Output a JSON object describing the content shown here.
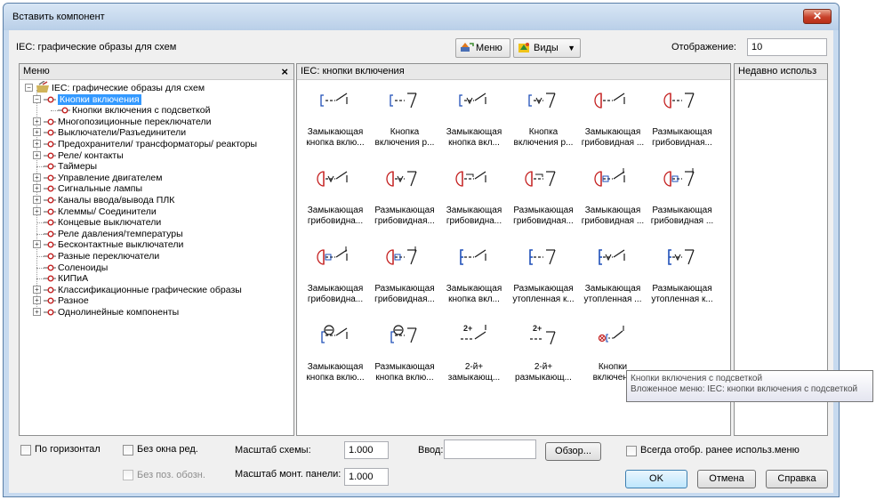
{
  "window": {
    "title": "Вставить компонент",
    "close_glyph": "✕"
  },
  "toolbar": {
    "path_label": "IEC: графические образы для схем",
    "menu_button": "Меню",
    "views_button": "Виды",
    "display_label": "Отображение:",
    "display_value": "10"
  },
  "menu_panel": {
    "header": "Меню",
    "close_glyph": "×",
    "tree": [
      {
        "label": "IEC: графические образы для схем",
        "level": 0,
        "expander": "−",
        "icon": "root"
      },
      {
        "label": "Кнопки включения",
        "level": 1,
        "expander": "−",
        "selected": true
      },
      {
        "label": "Кнопки включения с подсветкой",
        "level": 2,
        "expander": ""
      },
      {
        "label": "Многопозиционные переключатели",
        "level": 1,
        "expander": "+"
      },
      {
        "label": "Выключатели/Разъединители",
        "level": 1,
        "expander": "+"
      },
      {
        "label": "Предохранители/ трансформаторы/ реакторы",
        "level": 1,
        "expander": "+"
      },
      {
        "label": "Реле/ контакты",
        "level": 1,
        "expander": "+"
      },
      {
        "label": "Таймеры",
        "level": 1,
        "expander": ""
      },
      {
        "label": "Управление двигателем",
        "level": 1,
        "expander": "+"
      },
      {
        "label": "Сигнальные лампы",
        "level": 1,
        "expander": "+"
      },
      {
        "label": "Каналы ввода/вывода ПЛК",
        "level": 1,
        "expander": "+"
      },
      {
        "label": "Клеммы/ Соединители",
        "level": 1,
        "expander": "+"
      },
      {
        "label": "Концевые выключатели",
        "level": 1,
        "expander": ""
      },
      {
        "label": "Реле давления/температуры",
        "level": 1,
        "expander": ""
      },
      {
        "label": "Бесконтактные выключатели",
        "level": 1,
        "expander": "+"
      },
      {
        "label": "Разные переключатели",
        "level": 1,
        "expander": ""
      },
      {
        "label": "Соленоиды",
        "level": 1,
        "expander": ""
      },
      {
        "label": "КИПиА",
        "level": 1,
        "expander": ""
      },
      {
        "label": "Классификационные графические образы",
        "level": 1,
        "expander": "+"
      },
      {
        "label": "Разное",
        "level": 1,
        "expander": "+"
      },
      {
        "label": "Однолинейные компоненты",
        "level": 1,
        "expander": "+"
      }
    ]
  },
  "symbols_panel": {
    "header": "IEC: кнопки включения",
    "items": [
      {
        "line1": "Замыкающая",
        "line2": "кнопка вклю...",
        "icon": "pb-no"
      },
      {
        "line1": "Кнопка",
        "line2": "включения р...",
        "icon": "pb-nc"
      },
      {
        "line1": "Замыкающая",
        "line2": "кнопка вкл...",
        "icon": "pb-no-v"
      },
      {
        "line1": "Кнопка",
        "line2": "включения р...",
        "icon": "pb-nc-v"
      },
      {
        "line1": "Замыкающая",
        "line2": "грибовидная ...",
        "icon": "mush-no"
      },
      {
        "line1": "Размыкающая",
        "line2": "грибовидная...",
        "icon": "mush-nc"
      },
      {
        "line1": "Замыкающая",
        "line2": "грибовидна...",
        "icon": "mush-no-v"
      },
      {
        "line1": "Размыкающая",
        "line2": "грибовидная...",
        "icon": "mush-nc-v"
      },
      {
        "line1": "Замыкающая",
        "line2": "грибовидна...",
        "icon": "mush-no-latch"
      },
      {
        "line1": "Размыкающая",
        "line2": "грибовидная...",
        "icon": "mush-nc-latch"
      },
      {
        "line1": "Замыкающая",
        "line2": "грибовидная ...",
        "icon": "mush-no-key"
      },
      {
        "line1": "Размыкающая",
        "line2": "грибовидная ...",
        "icon": "mush-nc-key"
      },
      {
        "line1": "Замыкающая",
        "line2": "грибовидна...",
        "icon": "mush-no-key2"
      },
      {
        "line1": "Размыкающая",
        "line2": "грибовидная...",
        "icon": "mush-nc-key2"
      },
      {
        "line1": "Замыкающая",
        "line2": "кнопка вкл...",
        "icon": "flush-no"
      },
      {
        "line1": "Размыкающая",
        "line2": "утопленная к...",
        "icon": "flush-nc"
      },
      {
        "line1": "Замыкающая",
        "line2": "утопленная ...",
        "icon": "flush-no-v"
      },
      {
        "line1": "Размыкающая",
        "line2": "утопленная к...",
        "icon": "flush-nc-v"
      },
      {
        "line1": "Замыкающая",
        "line2": "кнопка вклю...",
        "icon": "theta-no"
      },
      {
        "line1": "Размыкающая",
        "line2": "кнопка вклю...",
        "icon": "theta-nc"
      },
      {
        "line1": "2-й+",
        "line2": "замыкающ...",
        "icon": "two-no"
      },
      {
        "line1": "2-й+",
        "line2": "размыкающ...",
        "icon": "two-nc"
      },
      {
        "line1": "Кнопки",
        "line2": "включени",
        "icon": "lit-no"
      }
    ]
  },
  "recent_panel": {
    "header": "Недавно использ"
  },
  "tooltip": {
    "line1": "Кнопки включения с подсветкой",
    "line2": "Вложенное меню: IEC: кнопки включения с подсветкой"
  },
  "bottom": {
    "horizontal_label": "По горизонтал",
    "no_edit_label": "Без окна ред.",
    "no_pos_label": "Без поз. обозн.",
    "scheme_scale_label": "Масштаб схемы:",
    "scheme_scale_value": "1.000",
    "panel_scale_label": "Масштаб монт. панели:",
    "panel_scale_value": "1.000",
    "input_label": "Ввод:",
    "input_value": "",
    "browse_button": "Обзор...",
    "always_show_label": "Всегда отобр. ранее использ.меню",
    "ok_button": "OK",
    "cancel_button": "Отмена",
    "help_button": "Справка"
  },
  "colors": {
    "accent_red": "#c42020",
    "accent_blue": "#1f4fb8",
    "selection": "#3399ff"
  }
}
